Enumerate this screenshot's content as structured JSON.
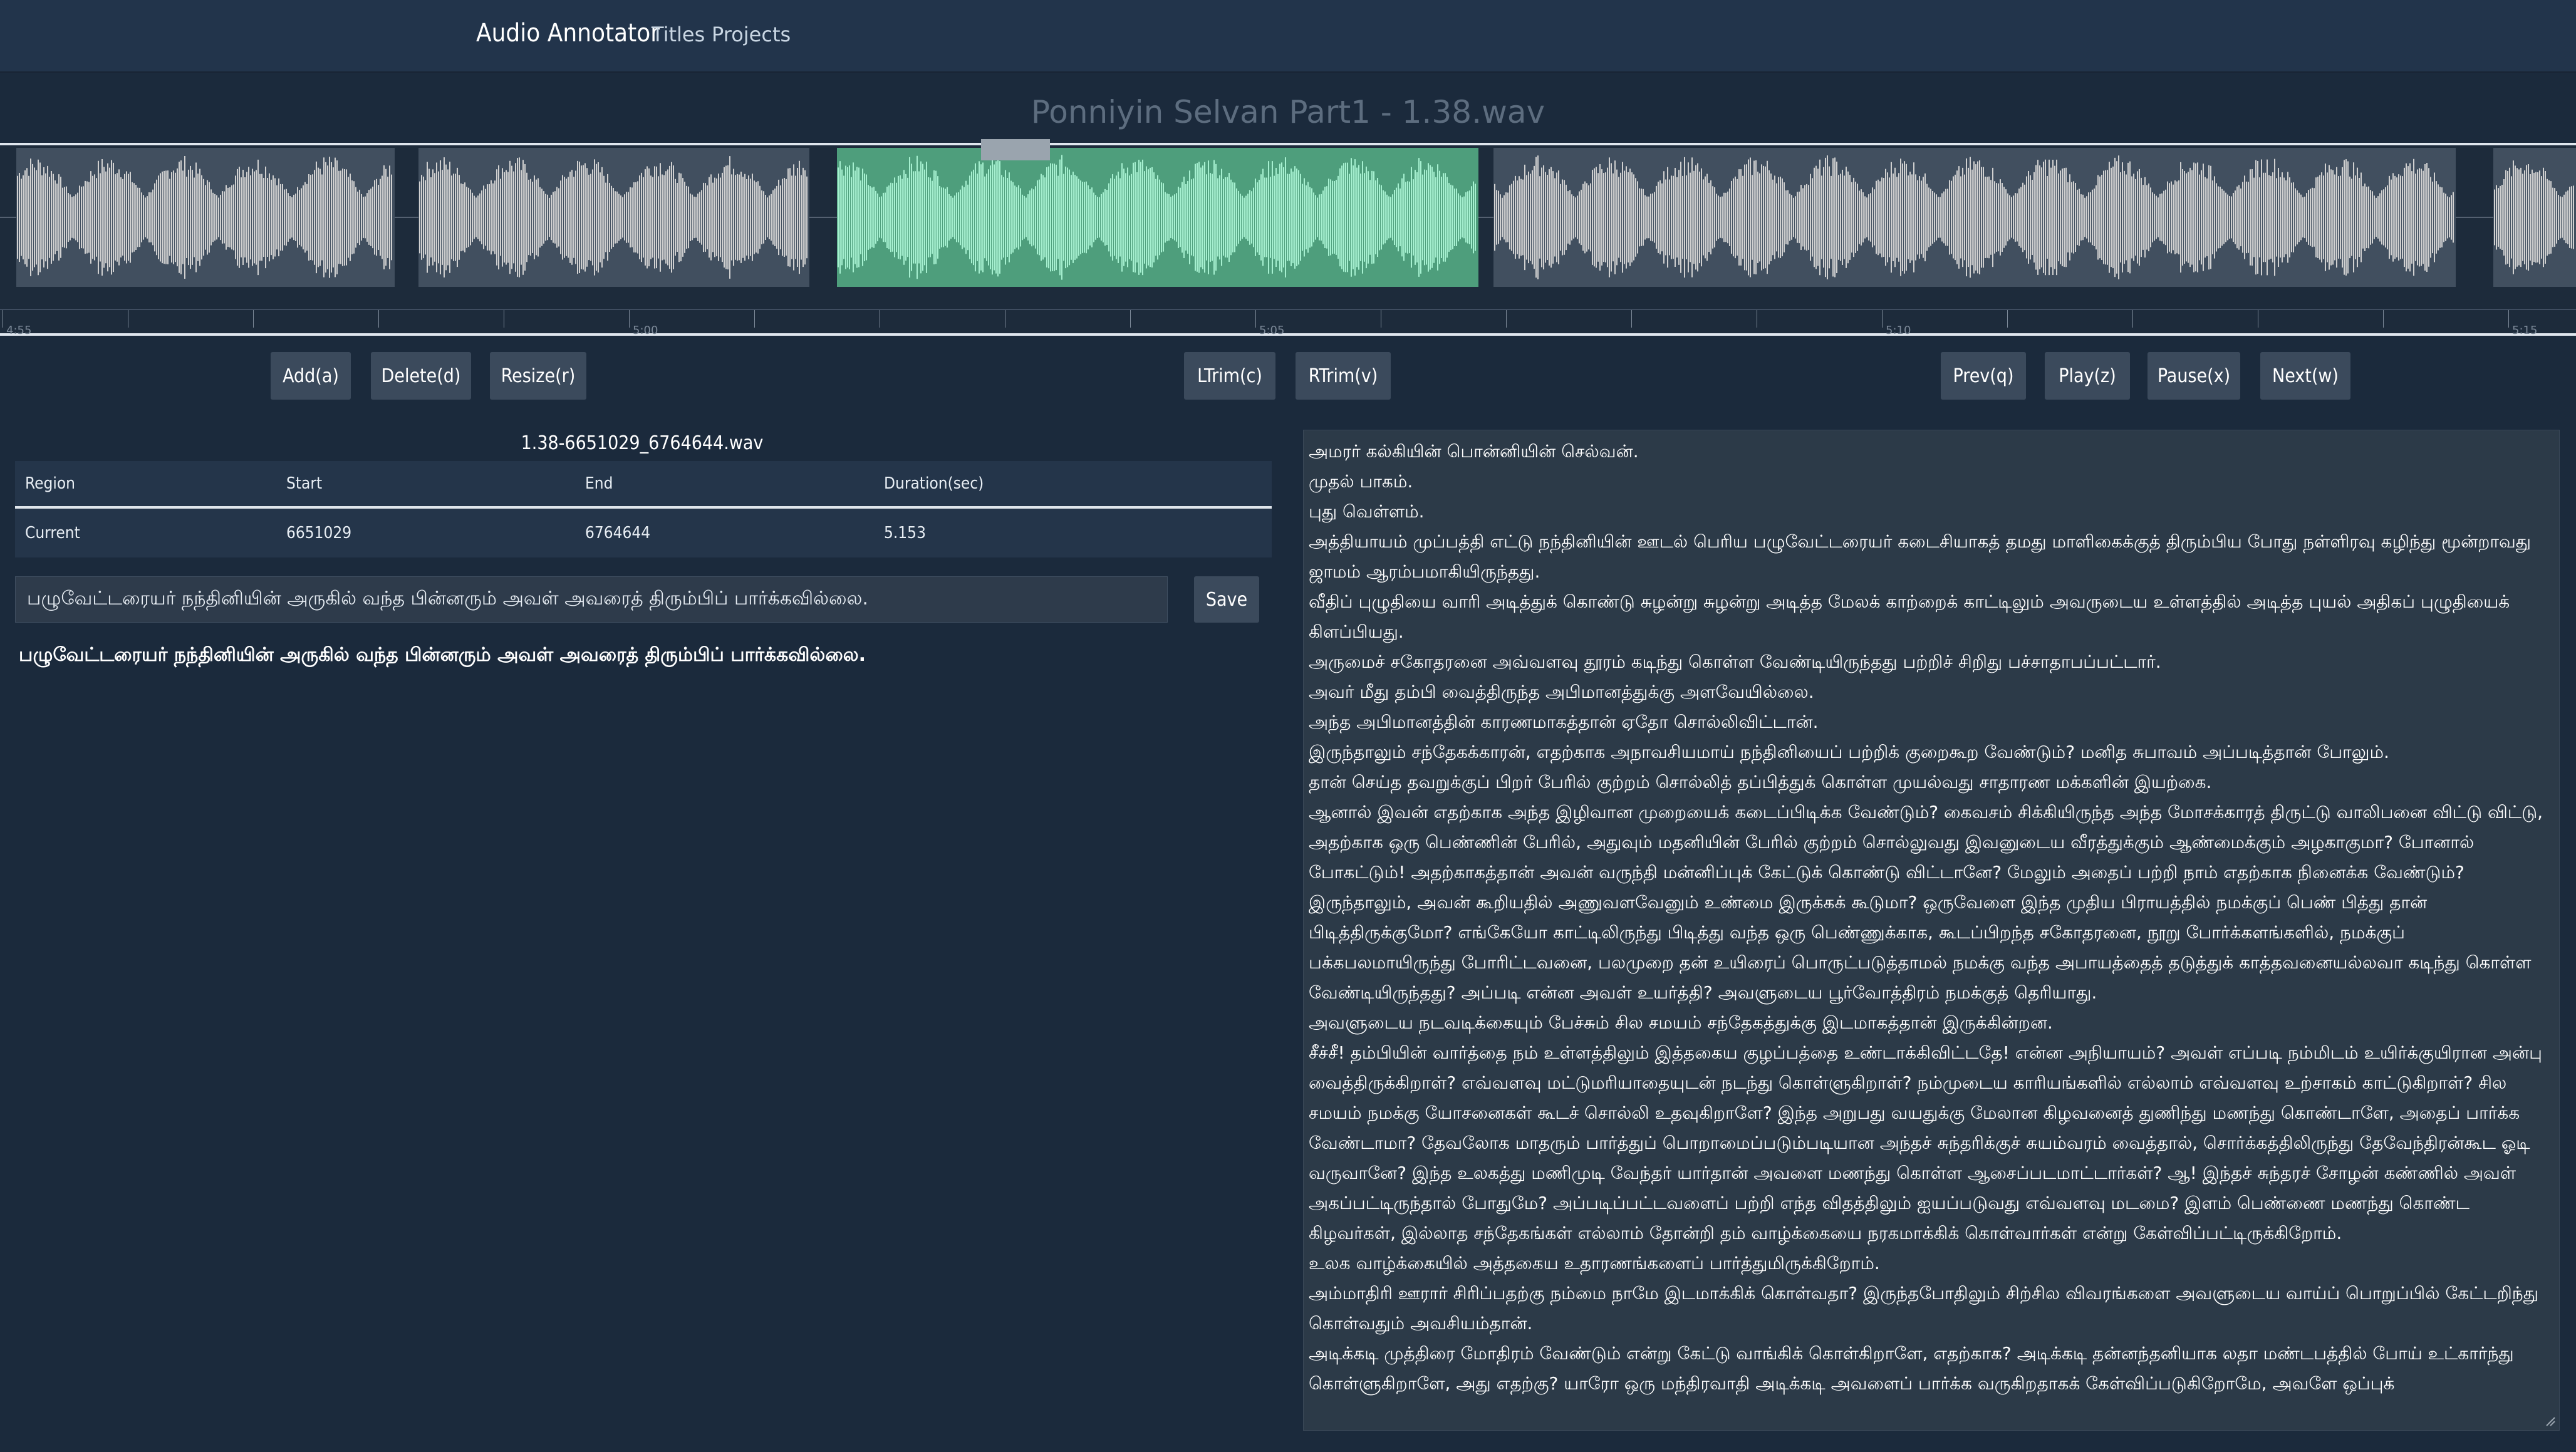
{
  "app": {
    "title": "Audio Annotator"
  },
  "nav": {
    "items": [
      "Titles",
      "Projects"
    ]
  },
  "file": {
    "name": "Ponniyin Selvan Part1 - 1.38.wav"
  },
  "timeline": {
    "labels": [
      "4:55",
      "5:00",
      "5:05",
      "5:10",
      "5:15"
    ]
  },
  "colors": {
    "accent": "#4e9e7c",
    "wave": "#d0d0d0",
    "wave_selected": "#a6f0d0",
    "background": "#1b2a3c"
  },
  "toolbar": {
    "add": "Add(a)",
    "delete": "Delete(d)",
    "resize": "Resize(r)",
    "ltrim": "LTrim(c)",
    "rtrim": "RTrim(v)",
    "prev": "Prev(q)",
    "play": "Play(z)",
    "pause": "Pause(x)",
    "next": "Next(w)"
  },
  "segment": {
    "filename": "1.38-6651029_6764644.wav",
    "headers": {
      "region": "Region",
      "start": "Start",
      "end": "End",
      "duration": "Duration(sec)"
    },
    "row": {
      "region": "Current",
      "start": "6651029",
      "end": "6764644",
      "duration": "5.153"
    }
  },
  "editor": {
    "text": "பழுவேட்டரையர் நந்தினியின் அருகில் வந்த பின்னரும் அவள் அவரைத் திரும்பிப் பார்க்கவில்லை.",
    "save": "Save",
    "preview": "பழுவேட்டரையர் நந்தினியின் அருகில் வந்த பின்னரும் அவள் அவரைத் திரும்பிப் பார்க்கவில்லை."
  },
  "transcript": [
    "அமரர் கல்கியின் பொன்னியின் செல்வன்.",
    "முதல் பாகம்.",
    "புது வெள்ளம்.",
    "அத்தியாயம் முப்பத்தி எட்டு நந்தினியின் ஊடல் பெரிய பழுவேட்டரையர் கடைசியாகத் தமது மாளிகைக்குத் திரும்பிய போது நள்ளிரவு கழிந்து மூன்றாவது ஜாமம் ஆரம்பமாகியிருந்தது.",
    "வீதிப் புழுதியை வாரி அடித்துக் கொண்டு சுழன்று சுழன்று அடித்த மேலக் காற்றைக் காட்டிலும் அவருடைய உள்ளத்தில் அடித்த புயல் அதிகப் புழுதியைக் கிளப்பியது.",
    "அருமைச் சகோதரனை அவ்வளவு தூரம் கடிந்து கொள்ள வேண்டியிருந்தது பற்றிச் சிறிது பச்சாதாபப்பட்டார்.",
    "அவர் மீது தம்பி வைத்திருந்த அபிமானத்துக்கு அளவேயில்லை.",
    "அந்த அபிமானத்தின் காரணமாகத்தான் ஏதோ சொல்லிவிட்டான்.",
    "இருந்தாலும் சந்தேகக்காரன், எதற்காக அநாவசியமாய் நந்தினியைப் பற்றிக் குறைகூற வேண்டும்? மனித சுபாவம் அப்படித்தான் போலும்.",
    "தான் செய்த தவறுக்குப் பிறர் பேரில் குற்றம் சொல்லித் தப்பித்துக் கொள்ள முயல்வது சாதாரண மக்களின் இயற்கை.",
    "ஆனால் இவன் எதற்காக அந்த இழிவான முறையைக் கடைப்பிடிக்க வேண்டும்? கைவசம் சிக்கியிருந்த அந்த மோசக்காரத் திருட்டு வாலிபனை விட்டு விட்டு, அதற்காக ஒரு பெண்ணின் பேரில், அதுவும் மதனியின் பேரில் குற்றம் சொல்லுவது இவனுடைய வீரத்துக்கும் ஆண்மைக்கும் அழகாகுமா? போனால் போகட்டும்! அதற்காகத்தான் அவன் வருந்தி மன்னிப்புக் கேட்டுக் கொண்டு விட்டானே? மேலும் அதைப் பற்றி நாம் எதற்காக நினைக்க வேண்டும்? இருந்தாலும், அவன் கூறியதில் அணுவளவேனும் உண்மை இருக்கக் கூடுமா? ஒருவேளை இந்த முதிய பிராயத்தில் நமக்குப் பெண் பித்து தான் பிடித்திருக்குமோ? எங்கேயோ காட்டிலிருந்து பிடித்து வந்த ஒரு பெண்ணுக்காக, கூடப்பிறந்த சகோதரனை, நூறு போர்க்களங்களில், நமக்குப் பக்கபலமாயிருந்து போரிட்டவனை, பலமுறை தன் உயிரைப் பொருட்படுத்தாமல் நமக்கு வந்த அபாயத்தைத் தடுத்துக் காத்தவனையல்லவா கடிந்து கொள்ள வேண்டியிருந்தது? அப்படி என்ன அவள் உயர்த்தி? அவளுடைய பூர்வோத்திரம் நமக்குத் தெரியாது.",
    "அவளுடைய நடவடிக்கையும் பேச்சும் சில சமயம் சந்தேகத்துக்கு இடமாகத்தான் இருக்கின்றன.",
    "சீச்சீ! தம்பியின் வார்த்தை நம் உள்ளத்திலும் இத்தகைய குழப்பத்தை உண்டாக்கிவிட்டதே! என்ன அநியாயம்? அவள் எப்படி நம்மிடம் உயிர்க்குயிரான அன்பு வைத்திருக்கிறாள்? எவ்வளவு மட்டுமரியாதையுடன் நடந்து கொள்ளுகிறாள்? நம்முடைய காரியங்களில் எல்லாம் எவ்வளவு உற்சாகம் காட்டுகிறாள்? சில சமயம் நமக்கு யோசனைகள் கூடச் சொல்லி உதவுகிறாளே? இந்த அறுபது வயதுக்கு மேலான கிழவனைத் துணிந்து மணந்து கொண்டாளே, அதைப் பார்க்க வேண்டாமா? தேவலோக மாதரும் பார்த்துப் பொறாமைப்படும்படியான அந்தச் சுந்தரிக்குச் சுயம்வரம் வைத்தால், சொர்க்கத்திலிருந்து தேவேந்திரன்கூட ஓடி வருவானே? இந்த உலகத்து மணிமுடி வேந்தர் யார்தான் அவளை மணந்து கொள்ள ஆசைப்படமாட்டார்கள்? ஆ! இந்தச் சுந்தரச் சோழன் கண்ணில் அவள் அகப்பட்டிருந்தால் போதுமே? அப்படிப்பட்டவளைப் பற்றி எந்த விதத்திலும் ஐயப்படுவது எவ்வளவு மடமை? இளம் பெண்ணை மணந்து கொண்ட கிழவர்கள், இல்லாத சந்தேகங்கள் எல்லாம் தோன்றி தம் வாழ்க்கையை நரகமாக்கிக் கொள்வார்கள் என்று கேள்விப்பட்டிருக்கிறோம்.",
    "உலக வாழ்க்கையில் அத்தகைய உதாரணங்களைப் பார்த்துமிருக்கிறோம்.",
    "அம்மாதிரி ஊரார் சிரிப்பதற்கு நம்மை நாமே இடமாக்கிக் கொள்வதா? இருந்தபோதிலும் சிற்சில விவரங்களை அவளுடைய வாய்ப் பொறுப்பில் கேட்டறிந்து கொள்வதும் அவசியம்தான்.",
    "அடிக்கடி முத்திரை மோதிரம் வேண்டும் என்று கேட்டு வாங்கிக் கொள்கிறாளே, எதற்காக? அடிக்கடி தன்னந்தனியாக லதா மண்டபத்தில் போய் உட்கார்ந்து கொள்ளுகிறாளே, அது எதற்கு? யாரோ ஒரு மந்திரவாதி அடிக்கடி அவளைப் பார்க்க வருகிறதாகக் கேள்விப்படுகிறோமே, அவளே ஒப்புக்"
  ]
}
